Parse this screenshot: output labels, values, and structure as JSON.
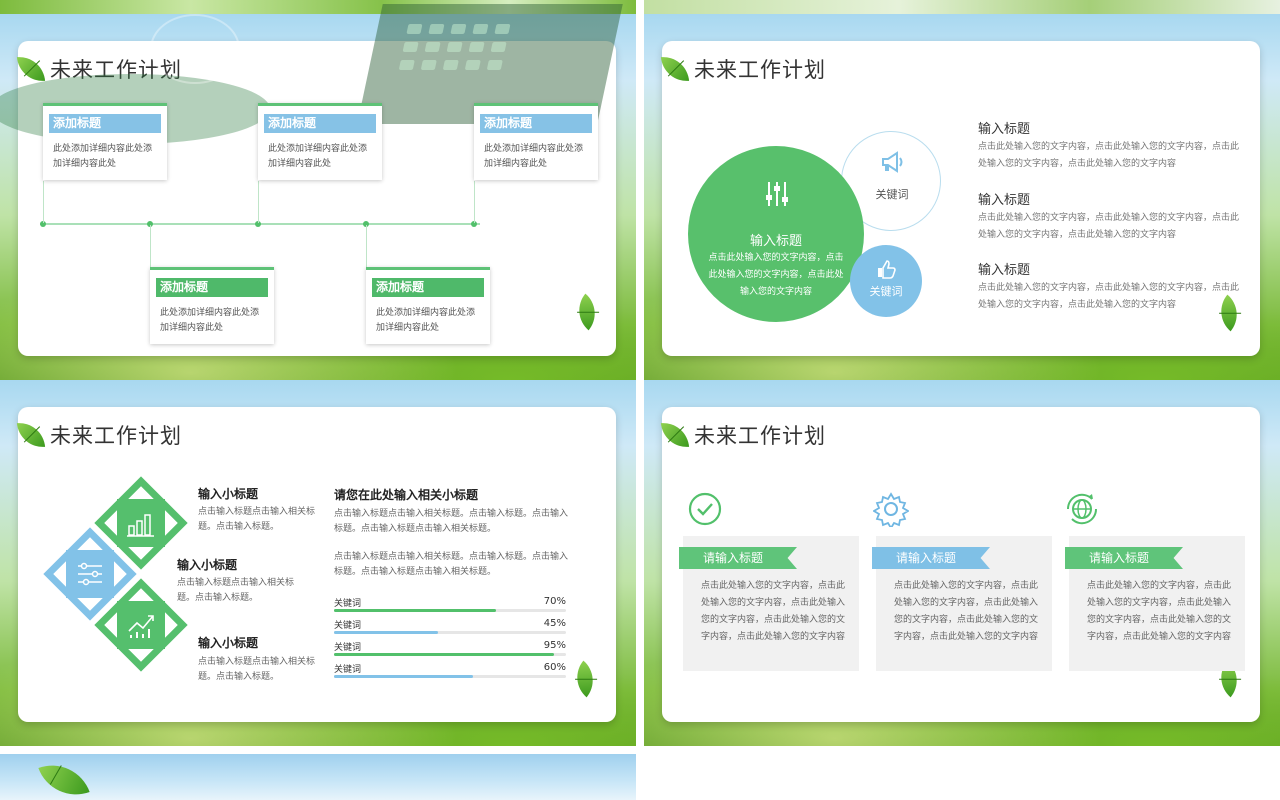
{
  "theme": {
    "green": "#52c06b",
    "blue": "#82c2e8",
    "title_color": "#333333"
  },
  "slides": {
    "s1": {
      "title": "未来工作计划",
      "boxes": [
        {
          "title": "添加标题",
          "text": "此处添加详细内容此处添加详细内容此处"
        },
        {
          "title": "添加标题",
          "text": "此处添加详细内容此处添加详细内容此处"
        },
        {
          "title": "添加标题",
          "text": "此处添加详细内容此处添加详细内容此处"
        },
        {
          "title": "添加标题",
          "text": "此处添加详细内容此处添加详细内容此处"
        },
        {
          "title": "添加标题",
          "text": "此处添加详细内容此处添加详细内容此处"
        }
      ]
    },
    "s2": {
      "title": "未来工作计划",
      "big": {
        "title": "输入标题",
        "text": "点击此处输入您的文字内容，点击此处输入您的文字内容，点击此处输入您的文字内容"
      },
      "keyword1": "关键词",
      "keyword2": "关键词",
      "items": [
        {
          "title": "输入标题",
          "text": "点击此处输入您的文字内容，点击此处输入您的文字内容，点击此处输入您的文字内容，点击此处输入您的文字内容"
        },
        {
          "title": "输入标题",
          "text": "点击此处输入您的文字内容，点击此处输入您的文字内容，点击此处输入您的文字内容，点击此处输入您的文字内容"
        },
        {
          "title": "输入标题",
          "text": "点击此处输入您的文字内容，点击此处输入您的文字内容，点击此处输入您的文字内容，点击此处输入您的文字内容"
        }
      ]
    },
    "s3": {
      "title": "未来工作计划",
      "subs": [
        {
          "title": "输入小标题",
          "text": "点击输入标题点击输入相关标题。点击输入标题。"
        },
        {
          "title": "输入小标题",
          "text": "点击输入标题点击输入相关标题。点击输入标题。"
        },
        {
          "title": "输入小标题",
          "text": "点击输入标题点击输入相关标题。点击输入标题。"
        }
      ],
      "right_title": "请您在此处输入相关小标题",
      "para1": "点击输入标题点击输入相关标题。点击输入标题。点击输入标题。点击输入标题点击输入相关标题。",
      "para2": "点击输入标题点击输入相关标题。点击输入标题。点击输入标题。点击输入标题点击输入相关标题。",
      "keywords": [
        {
          "label": "关键词",
          "pct": "70%",
          "value": 0.7,
          "color": "#52c06b"
        },
        {
          "label": "关键词",
          "pct": "45%",
          "value": 0.45,
          "color": "#82c2e8"
        },
        {
          "label": "关键词",
          "pct": "95%",
          "value": 0.95,
          "color": "#52c06b"
        },
        {
          "label": "关键词",
          "pct": "60%",
          "value": 0.6,
          "color": "#82c2e8"
        }
      ]
    },
    "s4": {
      "title": "未来工作计划",
      "cols": [
        {
          "title": "请输入标题",
          "text": "点击此处输入您的文字内容，点击此处输入您的文字内容，点击此处输入您的文字内容，点击此处输入您的文字内容，点击此处输入您的文字内容"
        },
        {
          "title": "请输入标题",
          "text": "点击此处输入您的文字内容，点击此处输入您的文字内容，点击此处输入您的文字内容，点击此处输入您的文字内容，点击此处输入您的文字内容"
        },
        {
          "title": "请输入标题",
          "text": "点击此处输入您的文字内容，点击此处输入您的文字内容，点击此处输入您的文字内容，点击此处输入您的文字内容，点击此处输入您的文字内容"
        }
      ],
      "icons": [
        "check-circle-icon",
        "gear-icon",
        "globe-refresh-icon"
      ]
    }
  }
}
